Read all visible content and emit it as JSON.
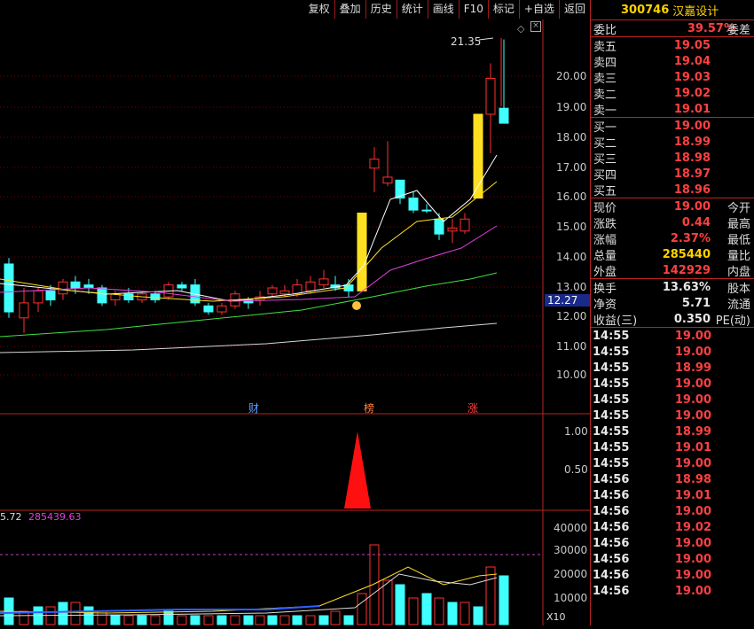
{
  "toolbar": {
    "buttons": [
      "复权",
      "叠加",
      "历史",
      "统计",
      "画线",
      "F10",
      "标记",
      "+自选",
      "返回"
    ]
  },
  "stock": {
    "code": "300746",
    "name": "汉嘉设计"
  },
  "order_book": {
    "ratio_label": "委比",
    "ratio_value": "39.57%",
    "diff_label": "委差",
    "sell": [
      {
        "label": "卖五",
        "price": "19.05"
      },
      {
        "label": "卖四",
        "price": "19.04"
      },
      {
        "label": "卖三",
        "price": "19.03"
      },
      {
        "label": "卖二",
        "price": "19.02"
      },
      {
        "label": "卖一",
        "price": "19.01"
      }
    ],
    "buy": [
      {
        "label": "买一",
        "price": "19.00"
      },
      {
        "label": "买二",
        "price": "18.99"
      },
      {
        "label": "买三",
        "price": "18.98"
      },
      {
        "label": "买四",
        "price": "18.97"
      },
      {
        "label": "买五",
        "price": "18.96"
      }
    ]
  },
  "quote": [
    {
      "label": "现价",
      "value": "19.00",
      "label2": "今开",
      "color": "red"
    },
    {
      "label": "涨跌",
      "value": "0.44",
      "label2": "最高",
      "color": "red"
    },
    {
      "label": "涨幅",
      "value": "2.37%",
      "label2": "最低",
      "color": "red"
    },
    {
      "label": "总量",
      "value": "285440",
      "label2": "量比",
      "color": "yel"
    },
    {
      "label": "外盘",
      "value": "142929",
      "label2": "内盘",
      "color": "red"
    }
  ],
  "stats": [
    {
      "label": "换手",
      "value": "13.63%",
      "label2": "股本"
    },
    {
      "label": "净资",
      "value": "5.71",
      "label2": "流通"
    },
    {
      "label": "收益(三)",
      "value": "0.350",
      "label2": "PE(动)"
    }
  ],
  "ticks": [
    {
      "time": "14:55",
      "price": "19.00"
    },
    {
      "time": "14:55",
      "price": "19.00"
    },
    {
      "time": "14:55",
      "price": "18.99"
    },
    {
      "time": "14:55",
      "price": "19.00"
    },
    {
      "time": "14:55",
      "price": "19.00"
    },
    {
      "time": "14:55",
      "price": "19.00"
    },
    {
      "time": "14:55",
      "price": "18.99"
    },
    {
      "time": "14:55",
      "price": "19.01"
    },
    {
      "time": "14:55",
      "price": "19.00"
    },
    {
      "time": "14:56",
      "price": "18.98"
    },
    {
      "time": "14:56",
      "price": "19.01"
    },
    {
      "time": "14:56",
      "price": "19.00"
    },
    {
      "time": "14:56",
      "price": "19.02"
    },
    {
      "time": "14:56",
      "price": "19.00"
    },
    {
      "time": "14:56",
      "price": "19.00"
    },
    {
      "time": "14:56",
      "price": "19.00"
    },
    {
      "time": "14:56",
      "price": "19.00"
    }
  ],
  "main_chart": {
    "y_ticks": [
      "20.00",
      "19.00",
      "18.00",
      "17.00",
      "16.00",
      "15.00",
      "14.00",
      "13.00",
      "12.00",
      "11.00",
      "10.00"
    ],
    "high_label": "21.35",
    "current_price_tag": "12.27",
    "markers": [
      "财",
      "榜",
      "涨"
    ]
  },
  "indicator_chart": {
    "y_ticks": [
      "1.00",
      "0.50"
    ]
  },
  "volume_chart": {
    "header_a": "5.72",
    "header_b": "285439.63",
    "y_ticks": [
      "40000",
      "30000",
      "20000",
      "10000"
    ],
    "unit": "X10"
  }
}
